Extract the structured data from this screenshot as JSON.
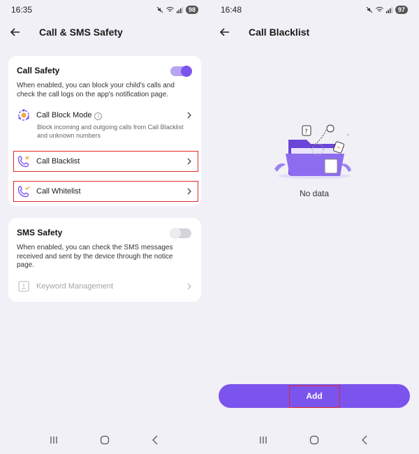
{
  "left": {
    "status": {
      "time": "16:35",
      "battery": "98"
    },
    "header": {
      "title": "Call & SMS Safety"
    },
    "call_safety": {
      "title": "Call Safety",
      "description": "When enabled, you can block your child's calls and check the call logs on the app's notification page.",
      "toggle_on": true,
      "block_mode_label": "Call Block Mode",
      "block_mode_info": "i",
      "block_mode_desc": "Block incoming and outgoing calls from Call Blacklist and unknown numbers",
      "blacklist_label": "Call Blacklist",
      "whitelist_label": "Call Whitelist"
    },
    "sms_safety": {
      "title": "SMS Safety",
      "description": "When enabled, you can check the SMS messages received and sent by the device through the notice page.",
      "toggle_on": false,
      "keyword_label": "Keyword Management"
    }
  },
  "right": {
    "status": {
      "time": "16:48",
      "battery": "97"
    },
    "header": {
      "title": "Call Blacklist"
    },
    "empty_text": "No data",
    "add_label": "Add"
  },
  "colors": {
    "accent": "#7b54ee",
    "highlight": "#e02b2b",
    "background": "#f1f0f6"
  }
}
